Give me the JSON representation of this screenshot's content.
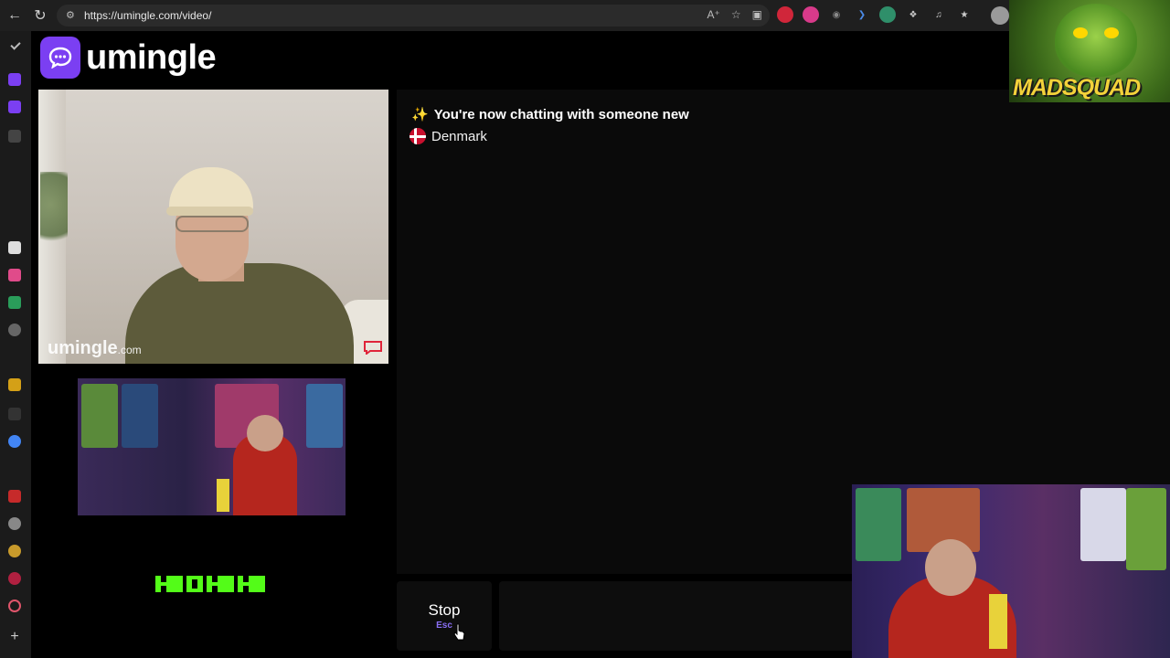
{
  "browser": {
    "url": "https://umingle.com/video/"
  },
  "site": {
    "brand_name": "umingle"
  },
  "partner_video": {
    "watermark_main": "umingle",
    "watermark_suffix": ".com"
  },
  "chat": {
    "status_text": "You're now chatting with someone new",
    "partner_country": "Denmark"
  },
  "controls": {
    "stop_label": "Stop",
    "stop_hint": "Esc",
    "message_placeholder": ""
  },
  "overlay": {
    "madsquad_text": "MADSQUAD"
  },
  "colors": {
    "brand_purple": "#7b3ff2",
    "kick_green": "#53fc18",
    "denmark_red": "#c8102e"
  }
}
